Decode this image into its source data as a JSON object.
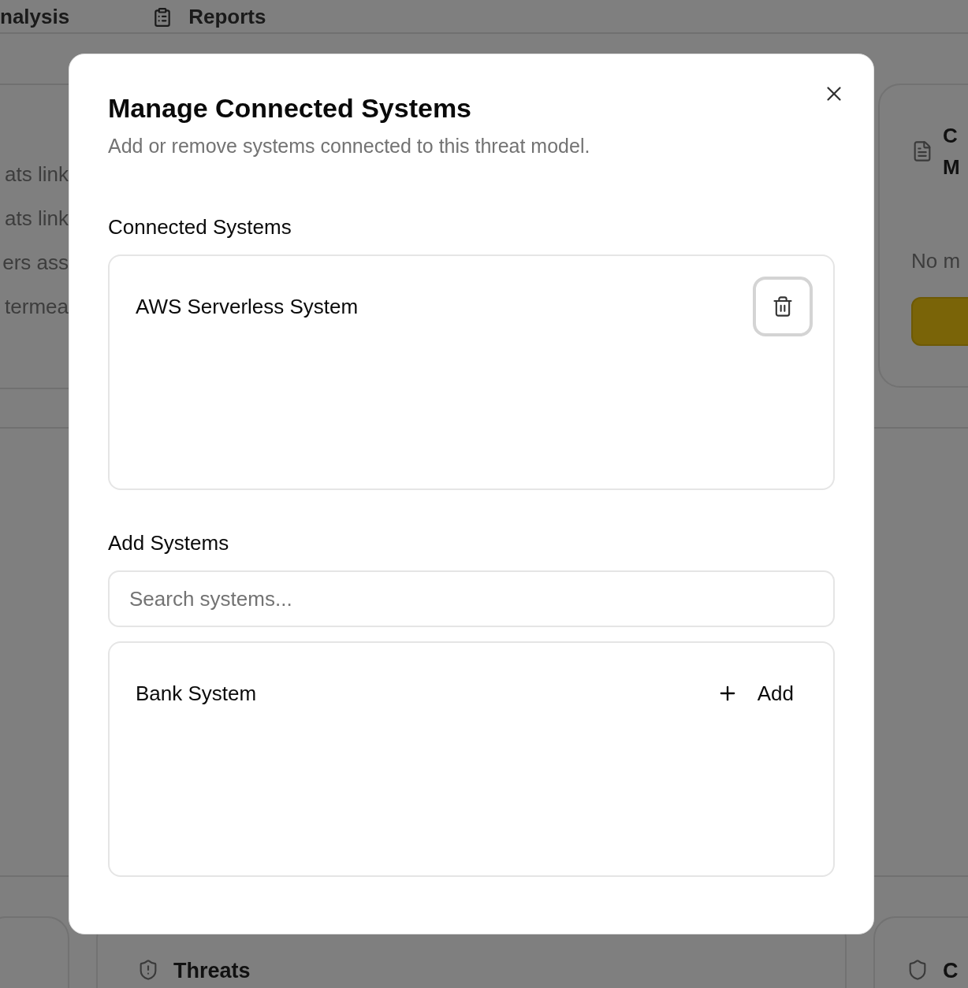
{
  "background": {
    "nav": [
      {
        "label": "nalysis",
        "icon": false
      },
      {
        "label": "Reports",
        "icon": true
      }
    ],
    "left_panel": {
      "lines": [
        "ats link",
        "ats link",
        "ers ass",
        "termea"
      ]
    },
    "right_panel": {
      "title_lines": [
        "C",
        "M"
      ],
      "text": "No m"
    },
    "bottom_cards": [
      {
        "label": "Threats",
        "kind": "alert"
      },
      {
        "label": "C",
        "kind": "plain"
      }
    ]
  },
  "dialog": {
    "title": "Manage Connected Systems",
    "subtitle": "Add or remove systems connected to this threat model.",
    "connected": {
      "heading": "Connected Systems",
      "items": [
        {
          "name": "AWS Serverless System"
        }
      ]
    },
    "add": {
      "heading": "Add Systems",
      "search": {
        "placeholder": "Search systems..."
      },
      "items": [
        {
          "name": "Bank System",
          "action": "Add"
        }
      ]
    }
  }
}
